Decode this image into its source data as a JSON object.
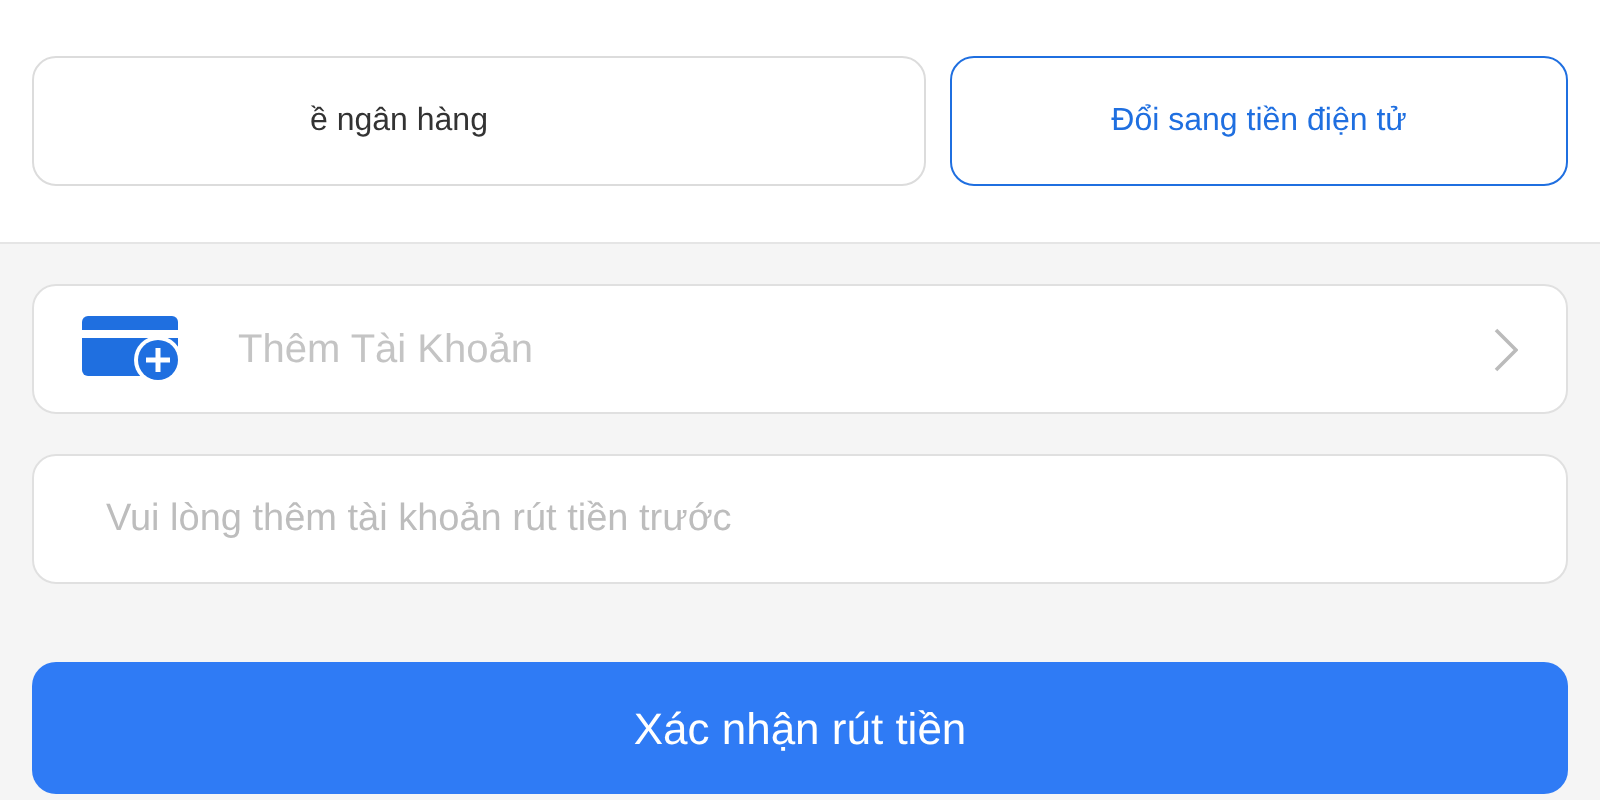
{
  "tabs": [
    {
      "label": "ề ngân hàng",
      "selected": false
    },
    {
      "label": "Đổi sang tiền điện tử",
      "selected": true
    }
  ],
  "account_row": {
    "label": "Thêm Tài Khoản"
  },
  "account_field": {
    "placeholder": "Vui lòng thêm tài khoản rút tiền trước"
  },
  "submit_button": {
    "label": "Xác nhận rút tiền"
  }
}
